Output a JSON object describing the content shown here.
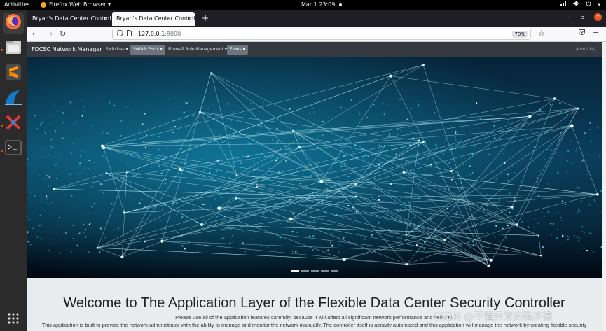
{
  "topbar": {
    "activities": "Activities",
    "app_menu": "Firefox Web Browser ▾",
    "clock": "Mar 1  23:09"
  },
  "dock": {
    "items": [
      "firefox-icon",
      "files-icon",
      "sublime-text-icon",
      "wireshark-icon",
      "xmind-icon",
      "terminal-icon",
      "show-apps-icon"
    ]
  },
  "browser": {
    "tabs": [
      {
        "title": "Bryan's Data Center Controlle",
        "close": "×"
      },
      {
        "title": "Bryan's Data Center Controlle",
        "close": "×"
      }
    ],
    "new_tab": "+",
    "url_host": "127.0.0.1",
    "url_port": ":8000",
    "zoom": "70%"
  },
  "site": {
    "brand": "FDCSC Network Manager",
    "nav": [
      {
        "label": "Switches ▾"
      },
      {
        "label": "Switch Ports ▾"
      },
      {
        "label": "Firewall Rule Management ▾"
      },
      {
        "label": "Flows ▾"
      }
    ],
    "about": "About Us",
    "welcome": "Welcome to The Application Layer of the Flexible Data Center Security Controller",
    "para1": "Please use all of the application features carefully, because it will affect all significant network performance and security.",
    "para2": "This application is built to provide the network administrator with the ability to manage and monitor the network manually. The controller itself is already automated and this application will manage the network by creating flexible security"
  },
  "watermark": "CSDN @不懂开发的程序猿"
}
